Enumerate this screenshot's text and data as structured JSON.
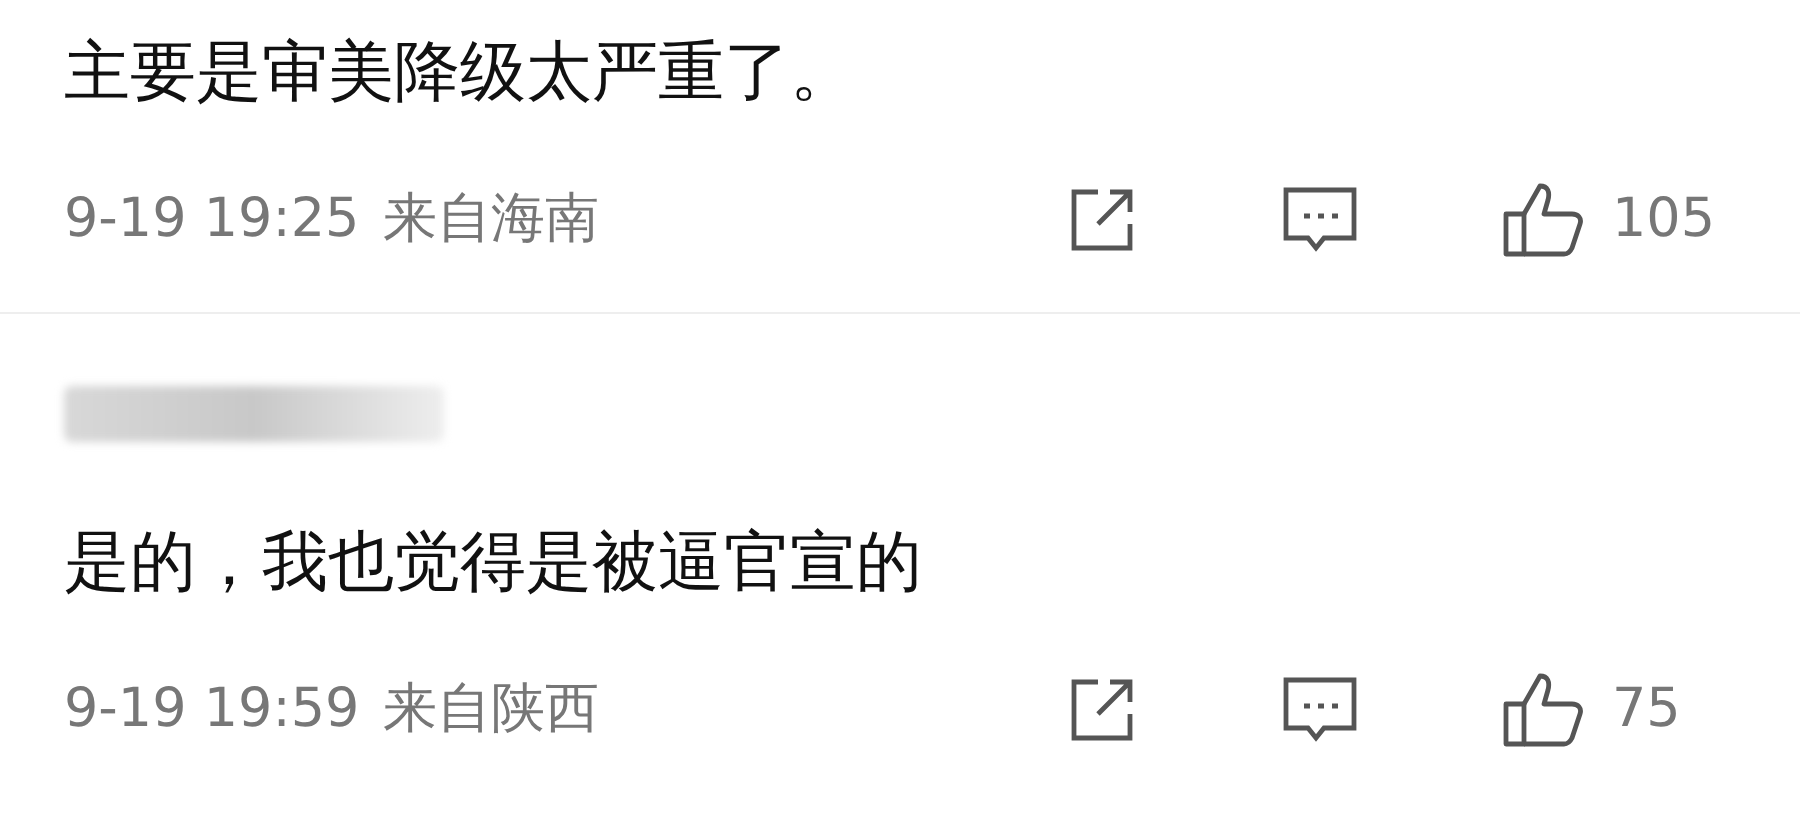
{
  "comments": [
    {
      "text": "主要是审美降级太严重了。",
      "time": "9-19 19:25",
      "location": "来自海南",
      "likes": "105"
    },
    {
      "name_redacted": true,
      "text": "是的，我也觉得是被逼官宣的",
      "time": "9-19 19:59",
      "location": "来自陕西",
      "likes": "75"
    }
  ]
}
